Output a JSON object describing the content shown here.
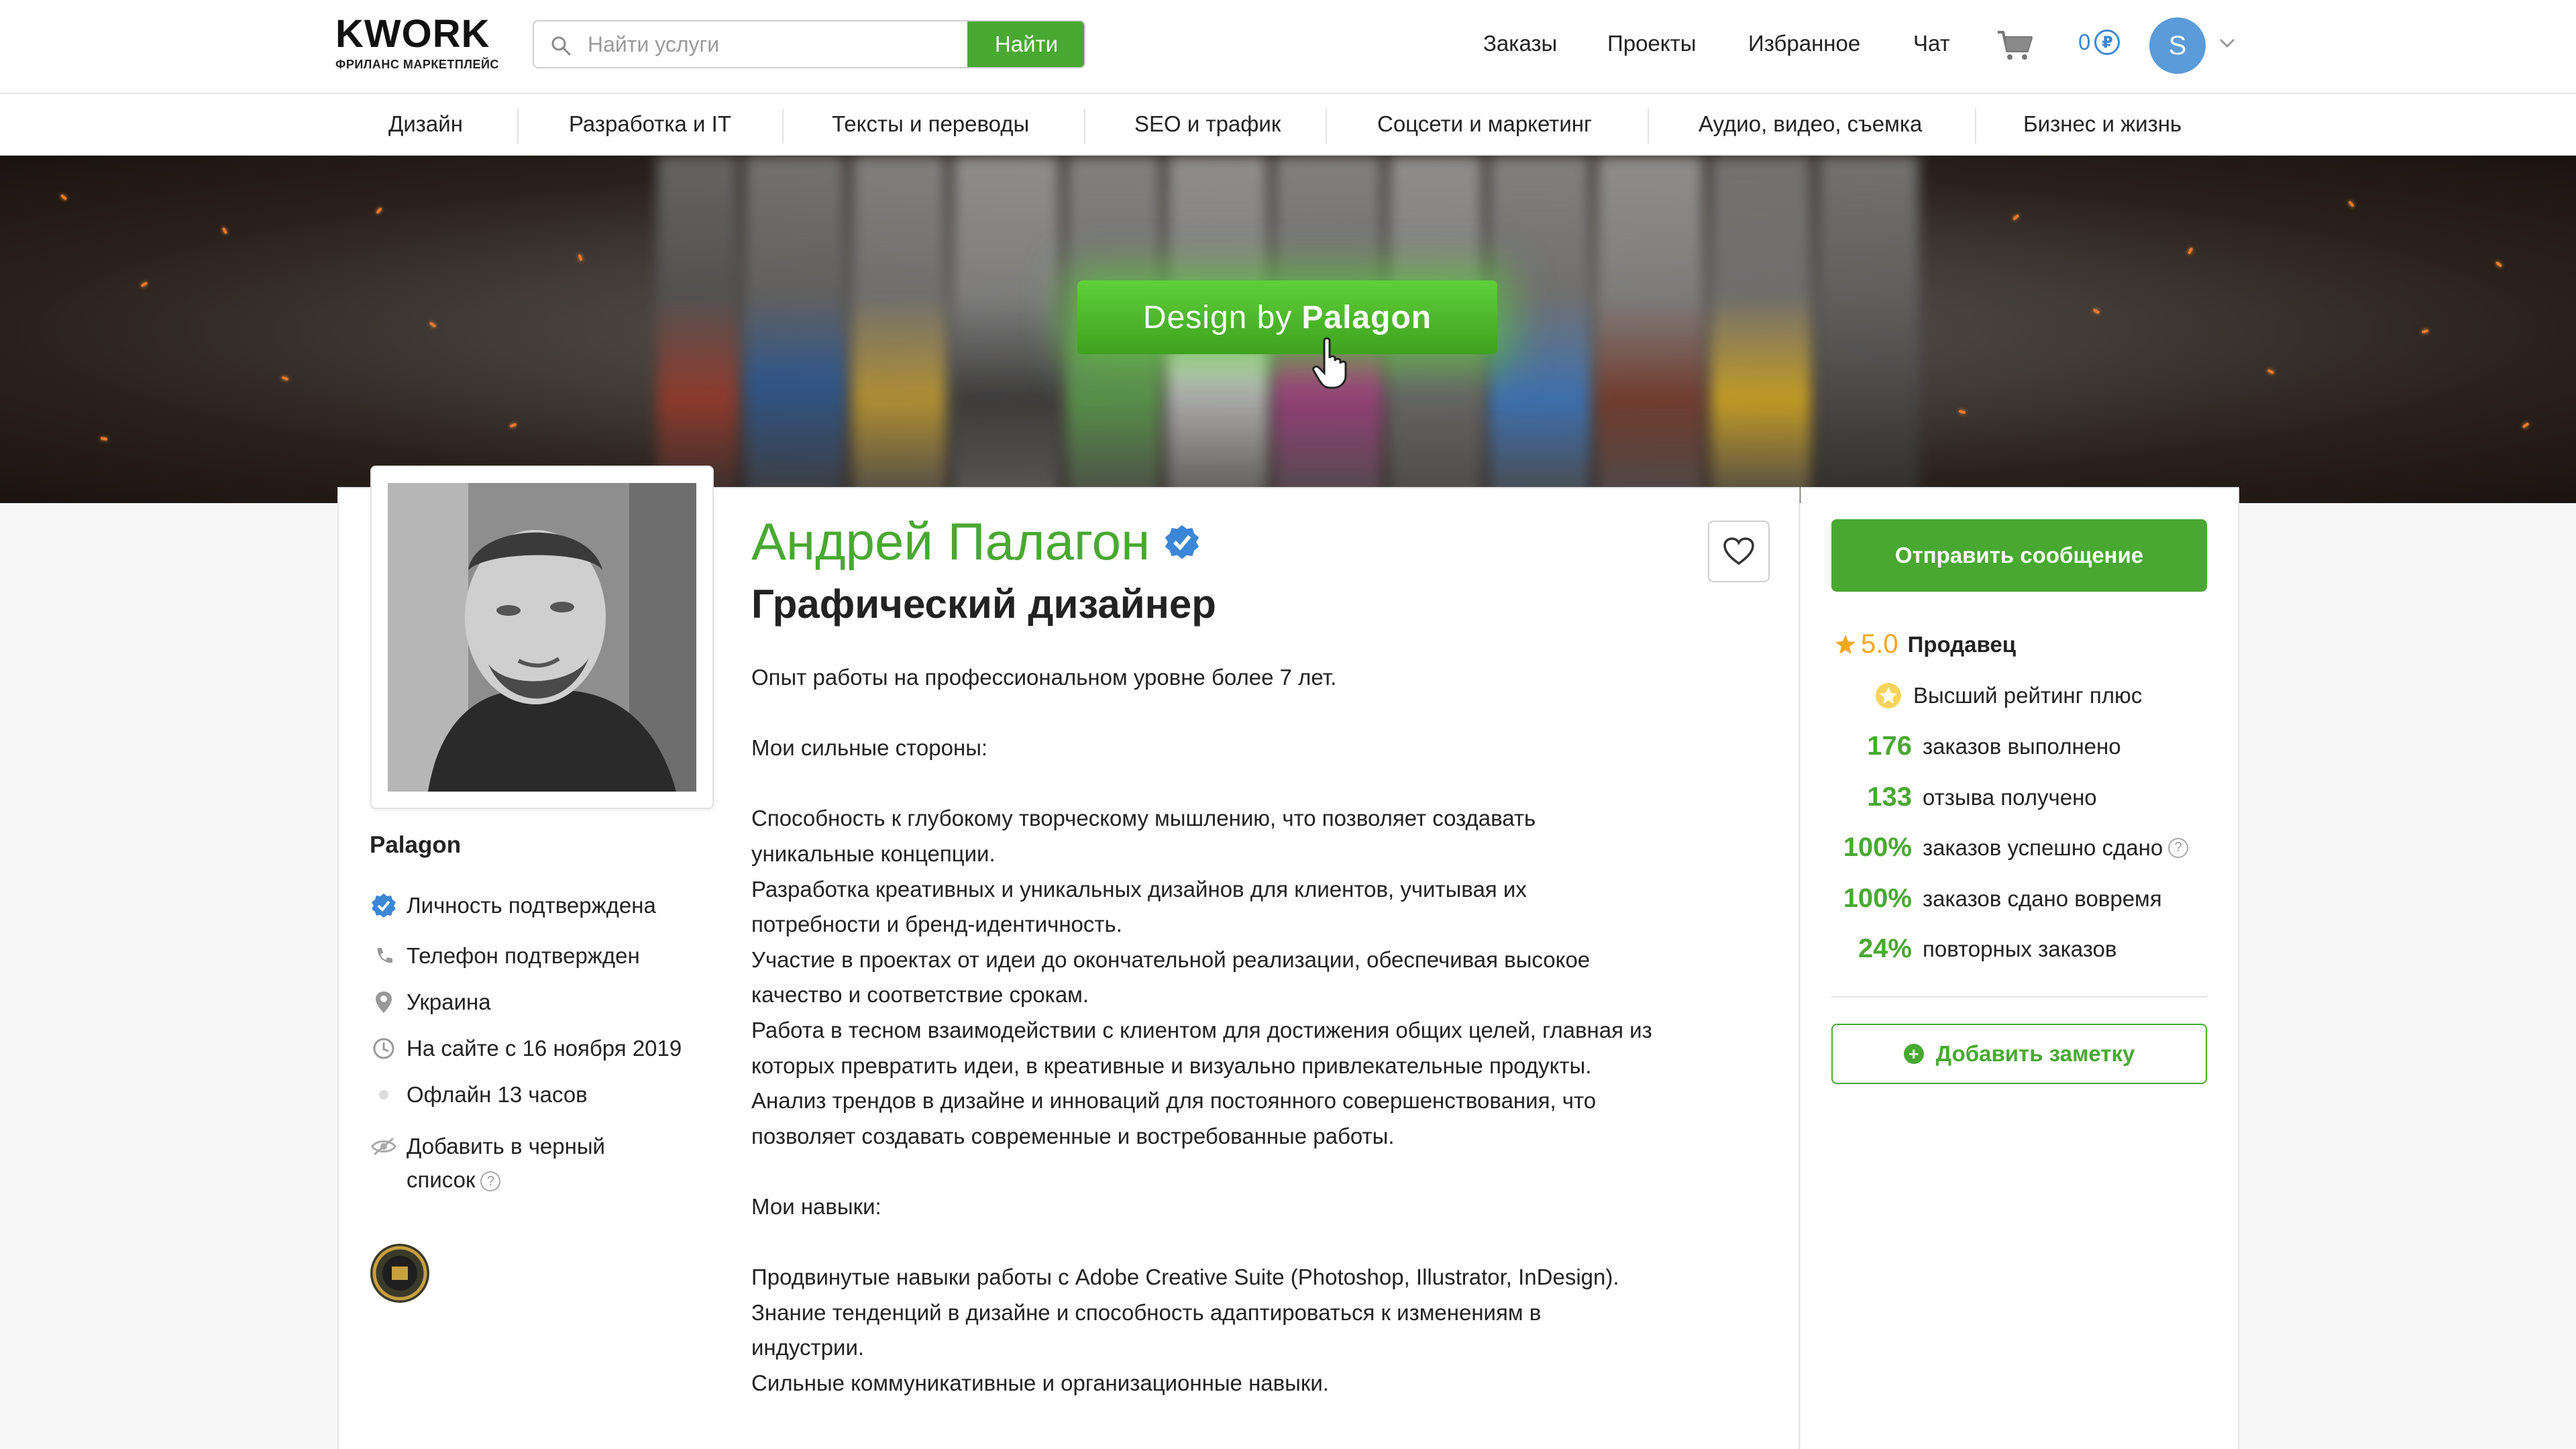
{
  "header": {
    "logo_word": "KWORK",
    "logo_sub": "ФРИЛАНС МАРКЕТПЛЕЙС",
    "search_placeholder": "Найти услуги",
    "search_button": "Найти",
    "nav": {
      "orders": "Заказы",
      "projects": "Проекты",
      "favorites": "Избранное",
      "chat": "Чат"
    },
    "balance": "0",
    "currency_symbol": "₽",
    "avatar_letter": "S"
  },
  "categories": [
    "Дизайн",
    "Разработка и IT",
    "Тексты и переводы",
    "SEO и трафик",
    "Соцсети и маркетинг",
    "Аудио, видео, съемка",
    "Бизнес и жизнь"
  ],
  "banner": {
    "button_text_prefix": "Design by",
    "button_text_bold": "Palagon"
  },
  "profile": {
    "display_name": "Андрей Палагон",
    "role": "Графический дизайнер",
    "username": "Palagon",
    "info": {
      "identity": "Личность подтверждена",
      "phone": "Телефон подтвержден",
      "country": "Украина",
      "since": "На сайте с 16 ноября 2019",
      "online": "Офлайн 13 часов",
      "blacklist_line1": "Добавить в черный",
      "blacklist_line2": "список"
    },
    "description": [
      "Опыт работы на профессиональном уровне более 7 лет.",
      "",
      "Мои сильные стороны:",
      "",
      "Способность к глубокому творческому мышлению, что позволяет создавать",
      "уникальные концепции.",
      "Разработка креативных и уникальных дизайнов для клиентов, учитывая их",
      "потребности и бренд-идентичность.",
      "Участие в проектах от идеи до окончательной реализации, обеспечивая высокое",
      "качество и соответствие срокам.",
      "Работа в тесном взаимодействии с клиентом для достижения общих целей, главная из",
      "которых превратить идеи, в креативные и визуально привлекательные продукты.",
      "Анализ трендов в дизайне и инноваций для постоянного совершенствования, что",
      "позволяет создавать современные и востребованные работы.",
      "",
      "Мои навыки:",
      "",
      "Продвинутые навыки работы с Adobe Creative Suite (Photoshop, Illustrator, InDesign).",
      "Знание тенденций в дизайне и способность адаптироваться к изменениям в",
      "индустрии.",
      "Сильные коммуникативные и организационные навыки."
    ]
  },
  "sidebar": {
    "message_button": "Отправить сообщение",
    "rating": "5.0",
    "rating_label": "Продавец",
    "top_rating": "Высший рейтинг плюс",
    "stats": [
      {
        "value": "176",
        "label": "заказов выполнено"
      },
      {
        "value": "133",
        "label": "отзыва получено"
      },
      {
        "value": "100%",
        "label": "заказов успешно сдано"
      },
      {
        "value": "100%",
        "label": "заказов сдано вовремя"
      },
      {
        "value": "24%",
        "label": "повторных заказов"
      }
    ],
    "note_button": "Добавить заметку"
  },
  "colors": {
    "brand_green": "#49a832",
    "link_blue": "#3b86d6",
    "star_gold": "#f2a81d"
  }
}
